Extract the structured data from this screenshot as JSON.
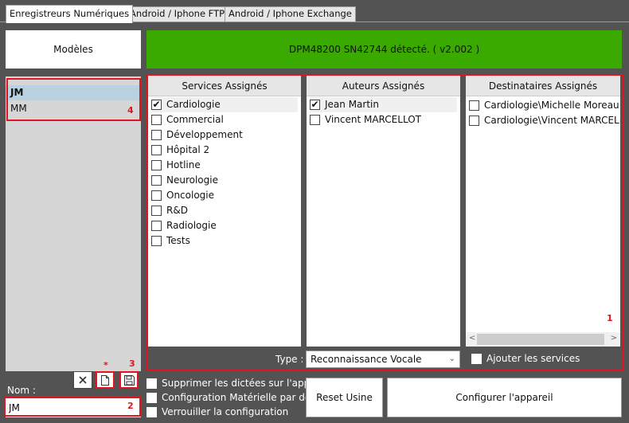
{
  "tabs": [
    {
      "label": "Enregistreurs Numériques"
    },
    {
      "label": "Android / Iphone FTP"
    },
    {
      "label": "Android / Iphone Exchange"
    }
  ],
  "models": {
    "header": "Modèles",
    "items": [
      {
        "label": "JM"
      },
      {
        "label": "MM"
      }
    ]
  },
  "status": {
    "text": "DPM48200 SN42744 détecté. ( v2.002 )",
    "color": "#3aaa00"
  },
  "services": {
    "header": "Services Assignés",
    "items": [
      {
        "label": "Cardiologie",
        "checked": true
      },
      {
        "label": "Commercial",
        "checked": false
      },
      {
        "label": "Développement",
        "checked": false
      },
      {
        "label": "Hôpital 2",
        "checked": false
      },
      {
        "label": "Hotline",
        "checked": false
      },
      {
        "label": "Neurologie",
        "checked": false
      },
      {
        "label": "Oncologie",
        "checked": false
      },
      {
        "label": "R&D",
        "checked": false
      },
      {
        "label": "Radiologie",
        "checked": false
      },
      {
        "label": "Tests",
        "checked": false
      }
    ]
  },
  "authors": {
    "header": "Auteurs Assignés",
    "items": [
      {
        "label": "Jean Martin",
        "checked": true
      },
      {
        "label": "Vincent MARCELLOT",
        "checked": false
      }
    ]
  },
  "recipients": {
    "header": "Destinataires Assignés",
    "items": [
      {
        "label": "Cardiologie\\Michelle Moreau",
        "checked": false
      },
      {
        "label": "Cardiologie\\Vincent MARCELLOT",
        "checked": false
      }
    ]
  },
  "type": {
    "label": "Type :",
    "value": "Reconnaissance Vocale"
  },
  "add_services": {
    "label": "Ajouter les services",
    "checked": true
  },
  "options": [
    {
      "label": "Supprimer les dictées sur l'appareil",
      "checked": false
    },
    {
      "label": "Configuration Matérielle par défaut",
      "checked": true
    },
    {
      "label": "Verrouiller la configuration",
      "checked": false
    }
  ],
  "nom": {
    "label": "Nom :",
    "value": "JM"
  },
  "buttons": {
    "reset": "Reset Usine",
    "configure": "Configurer l'appareil"
  },
  "annotations": {
    "n1": "1",
    "n2": "2",
    "n3": "3",
    "n4": "4",
    "star": "*"
  },
  "colors": {
    "accent_red": "#e2141f",
    "selection": "#b9d1e1"
  },
  "icons": [
    "close-icon",
    "new-document-icon",
    "save-icon",
    "checkmark-icon",
    "chevron-down-icon"
  ]
}
